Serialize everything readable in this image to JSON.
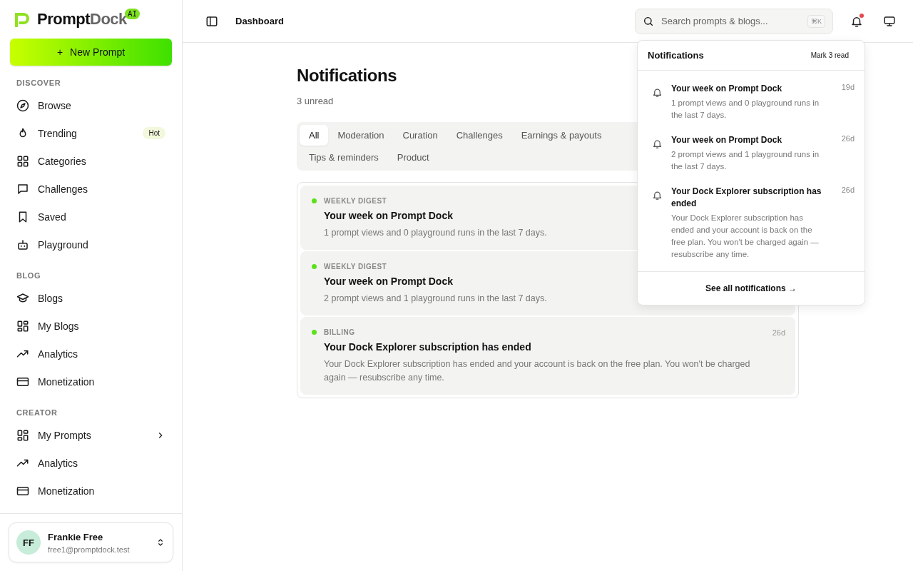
{
  "brand": {
    "name_main": "Prompt",
    "name_accent": "Dock",
    "badge": "AI"
  },
  "new_prompt_button": {
    "icon": "+",
    "label": "New Prompt"
  },
  "sidebar": {
    "sections": [
      {
        "title": "DISCOVER",
        "items": [
          {
            "label": "Browse",
            "selected": false
          },
          {
            "label": "Trending",
            "badge": "Hot",
            "selected": false
          },
          {
            "label": "Categories",
            "selected": false
          },
          {
            "label": "Challenges",
            "selected": false
          },
          {
            "label": "Saved",
            "selected": false
          },
          {
            "label": "Playground",
            "selected": false
          }
        ]
      },
      {
        "title": "BLOG",
        "items": [
          {
            "label": "Blogs",
            "selected": false
          },
          {
            "label": "My Blogs",
            "selected": false
          },
          {
            "label": "Analytics",
            "selected": false
          },
          {
            "label": "Monetization",
            "selected": false
          }
        ]
      },
      {
        "title": "CREATOR",
        "items": [
          {
            "label": "My Prompts",
            "has_submenu": true,
            "selected": false
          },
          {
            "label": "Analytics",
            "selected": false
          },
          {
            "label": "Monetization",
            "selected": false
          }
        ]
      }
    ]
  },
  "user": {
    "initials": "FF",
    "name": "Frankie Free",
    "email": "free1@promptdock.test"
  },
  "header": {
    "title": "Dashboard",
    "search": {
      "placeholder": "Search prompts & blogs...",
      "shortcut": "⌘K"
    },
    "has_unread": true
  },
  "page": {
    "title": "Notifications",
    "subtitle": "3 unread",
    "tabs": [
      {
        "label": "All",
        "selected": true
      },
      {
        "label": "Moderation",
        "selected": false
      },
      {
        "label": "Curation",
        "selected": false
      },
      {
        "label": "Challenges",
        "selected": false
      },
      {
        "label": "Earnings & payouts",
        "selected": false
      },
      {
        "label": "Tips & reminders",
        "selected": false
      },
      {
        "label": "Product",
        "selected": false
      }
    ],
    "notifications": [
      {
        "category": "WEEKLY DIGEST",
        "title": "Your week on Prompt Dock",
        "body": "1 prompt views and 0 playground runs in the last 7 days.",
        "unread": true
      },
      {
        "category": "WEEKLY DIGEST",
        "title": "Your week on Prompt Dock",
        "body": "2 prompt views and 1 playground runs in the last 7 days.",
        "unread": true
      },
      {
        "category": "BILLING",
        "title": "Your Dock Explorer subscription has ended",
        "body": "Your Dock Explorer subscription has ended and your account is back on the free plan. You won't be charged again — resubscribe any time.",
        "time": "26d",
        "unread": true
      }
    ]
  },
  "dropdown": {
    "title": "Notifications",
    "mark_read": "Mark 3 read",
    "items": [
      {
        "title": "Your week on Prompt Dock",
        "body": "1 prompt views and 0 playground runs in the last 7 days.",
        "time": "19d"
      },
      {
        "title": "Your week on Prompt Dock",
        "body": "2 prompt views and 1 playground runs in the last 7 days.",
        "time": "26d"
      },
      {
        "title": "Your Dock Explorer subscription has ended",
        "body": "Your Dock Explorer subscription has ended and your account is back on the free plan. You won't be charged again — resubscribe any time.",
        "time": "26d"
      }
    ],
    "footer": "See all notifications →"
  }
}
